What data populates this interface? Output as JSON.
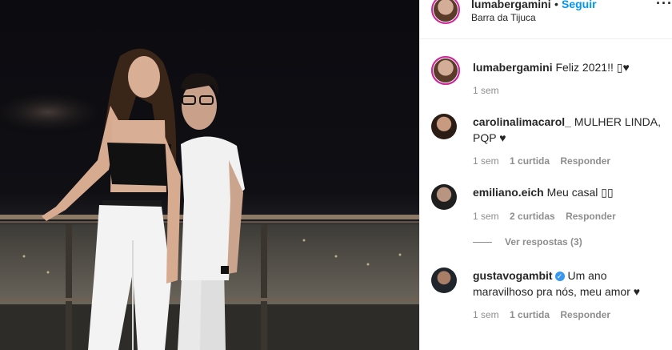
{
  "post": {
    "username": "lumabergamini",
    "separator": "•",
    "follow_label": "Seguir",
    "location": "Barra da Tijuca",
    "more_icon": "more-options-icon"
  },
  "caption": {
    "username": "lumabergamini",
    "text": "Feliz 2021!! ▯♥",
    "time": "1 sem"
  },
  "comments": [
    {
      "username": "carolinalimacarol_",
      "text": "MULHER LINDA, PQP ♥",
      "time": "1 sem",
      "likes": "1 curtida",
      "reply": "Responder"
    },
    {
      "username": "emiliano.eich",
      "text": "Meu casal ▯▯",
      "time": "1 sem",
      "likes": "2 curtidas",
      "reply": "Responder",
      "view_replies": "Ver respostas (3)"
    },
    {
      "username": "gustavogambit",
      "verified": true,
      "text": "Um ano maravilhoso pra nós, meu amor ♥",
      "time": "1 sem",
      "likes": "1 curtida",
      "reply": "Responder"
    }
  ],
  "colors": {
    "link_blue": "#0095f6",
    "muted": "#8e8e8e",
    "text": "#262626",
    "story_ring": "#d6249f"
  }
}
